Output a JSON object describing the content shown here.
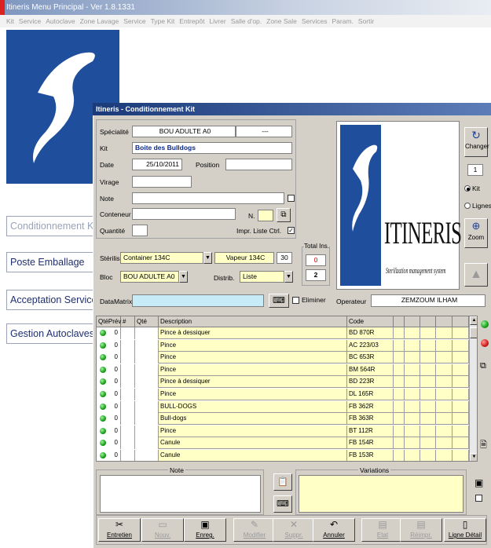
{
  "main_window": {
    "title": "Itineris Menu Principal   - Ver 1.8.1331",
    "menu": [
      "Kit",
      "Service",
      "Autoclave",
      "Zone Lavage",
      "Service",
      "Type Kit",
      "Entrepôt",
      "Livrer",
      "Salle d'op.",
      "Zone Sale",
      "Services",
      "Param.",
      "Sortir"
    ],
    "side_buttons": [
      "Conditionnement Kit",
      "Poste Emballage",
      "Acceptation Service",
      "Gestion Autoclaves"
    ]
  },
  "dialog": {
    "title": "Itineris - Conditionnement Kit",
    "labels": {
      "specialite": "Spécialité",
      "kit": "Kit",
      "date": "Date",
      "position": "Position",
      "virage": "Virage",
      "note": "Note",
      "conteneur": "Conteneur",
      "n": "N.",
      "quantite": "Quantité",
      "impr": "Impr. Liste Ctrl.",
      "sterilis": "Stérilis.",
      "bloc": "Bloc",
      "distrib": "Distrib.",
      "total_ins": "Total Ins.",
      "datamatrix": "DataMatrix",
      "eliminer": "Eliminer",
      "operateur": "Operateur"
    },
    "values": {
      "specialite": "BOU ADULTE A0",
      "specialite2": "---",
      "kit": "Boite des Bulldogs",
      "date": "25/10/2011",
      "position": "",
      "virage": "",
      "note": "",
      "conteneur": "",
      "n": "",
      "quantite": "",
      "sterilis": "Container 134C",
      "vapeur": "Vapeur 134C",
      "vapeur_num": "30",
      "bloc": "BOU ADULTE A0",
      "distrib": "Liste",
      "total_red": "0",
      "total": "2",
      "datamatrix": "",
      "operateur": "ZEMZOUM ILHAM",
      "kit_count": "1"
    },
    "impr_checked": "✓",
    "logo": {
      "word": "ITINERIS",
      "tagline": "Sterilization management system"
    },
    "right_buttons": {
      "changer": "Changer",
      "kit": "Kit",
      "lignes": "Lignes",
      "zoom": "Zoom"
    },
    "table": {
      "headers": [
        "QtéPrév",
        "#",
        "Qté",
        "Description",
        "Code"
      ],
      "rows": [
        {
          "qte_prev": "0",
          "desc": "Pince à dessiquer",
          "code": "BD 870R"
        },
        {
          "qte_prev": "0",
          "desc": "Pince",
          "code": "AC 223/03"
        },
        {
          "qte_prev": "0",
          "desc": "Pince",
          "code": "BC 653R"
        },
        {
          "qte_prev": "0",
          "desc": "Pince",
          "code": "BM 564R"
        },
        {
          "qte_prev": "0",
          "desc": "Pince à dessiquer",
          "code": "BD 223R"
        },
        {
          "qte_prev": "0",
          "desc": "Pince",
          "code": "DL 165R"
        },
        {
          "qte_prev": "0",
          "desc": "BULL-DOGS",
          "code": "FB 362R"
        },
        {
          "qte_prev": "0",
          "desc": "Bull-dogs",
          "code": "FB 363R"
        },
        {
          "qte_prev": "0",
          "desc": "Pince",
          "code": "BT 112R"
        },
        {
          "qte_prev": "0",
          "desc": "Canule",
          "code": "FB 154R"
        },
        {
          "qte_prev": "0",
          "desc": "Canule",
          "code": "FB 153R"
        }
      ]
    },
    "note_label": "Note",
    "variations_label": "Variations",
    "bottom_buttons": [
      {
        "label": "Entretien",
        "icon": "✂",
        "enabled": true
      },
      {
        "label": "Nouv.",
        "icon": "▭",
        "enabled": false
      },
      {
        "label": "Enreg.",
        "icon": "▣",
        "enabled": true
      },
      {
        "label": "Modifier",
        "icon": "✎",
        "enabled": false
      },
      {
        "label": "Suppr.",
        "icon": "✕",
        "enabled": false
      },
      {
        "label": "Annuler",
        "icon": "↶",
        "enabled": true
      },
      {
        "label": "Etat",
        "icon": "▤",
        "enabled": false
      },
      {
        "label": "Réimpr.",
        "icon": "▤",
        "enabled": false
      },
      {
        "label": "Ligne Détail",
        "icon": "▯",
        "enabled": true
      }
    ]
  }
}
